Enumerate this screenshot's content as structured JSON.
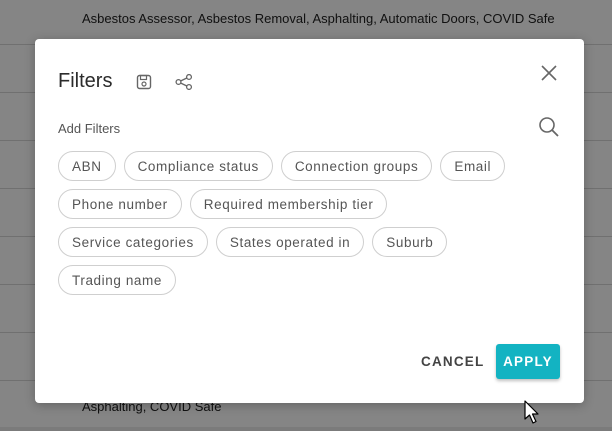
{
  "background": {
    "rows": [
      "Asbestos Assessor, Asbestos Removal, Asphalting, Automatic Doors, COVID Safe",
      "Asphalting, COVID Safe"
    ]
  },
  "modal": {
    "title": "Filters",
    "subtitle": "Add Filters",
    "icons": {
      "save": "save-icon",
      "share": "share-icon",
      "close": "close-icon",
      "search": "search-icon"
    },
    "chips": [
      [
        "ABN",
        "Compliance status",
        "Connection groups",
        "Email"
      ],
      [
        "Phone number",
        "Required membership tier"
      ],
      [
        "Service categories",
        "States operated in",
        "Suburb"
      ],
      [
        "Trading name"
      ]
    ],
    "cancel_label": "CANCEL",
    "apply_label": "APPLY"
  },
  "colors": {
    "accent": "#13b3c2",
    "chip_border": "#cfcfcf",
    "overlay": "rgba(0,0,0,0.48)"
  }
}
